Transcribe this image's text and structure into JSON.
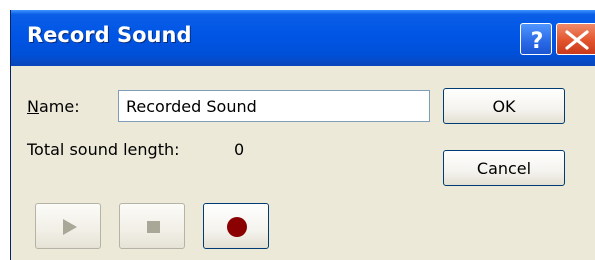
{
  "window": {
    "title": "Record Sound",
    "help_icon": "help-question-icon",
    "close_icon": "close-x-icon"
  },
  "form": {
    "name_label": "Name:",
    "name_value": "Recorded Sound",
    "length_label": "Total sound length:",
    "length_value": "0"
  },
  "buttons": {
    "ok": "OK",
    "cancel": "Cancel"
  },
  "media": {
    "play": {
      "icon": "play-icon",
      "enabled": false
    },
    "stop": {
      "icon": "stop-icon",
      "enabled": false
    },
    "record": {
      "icon": "record-icon",
      "enabled": true
    }
  },
  "colors": {
    "titlebar": "#0055e5",
    "dialog_bg": "#ece9d8",
    "record_dot": "#8b0000",
    "disabled_glyph": "#a9a797"
  }
}
